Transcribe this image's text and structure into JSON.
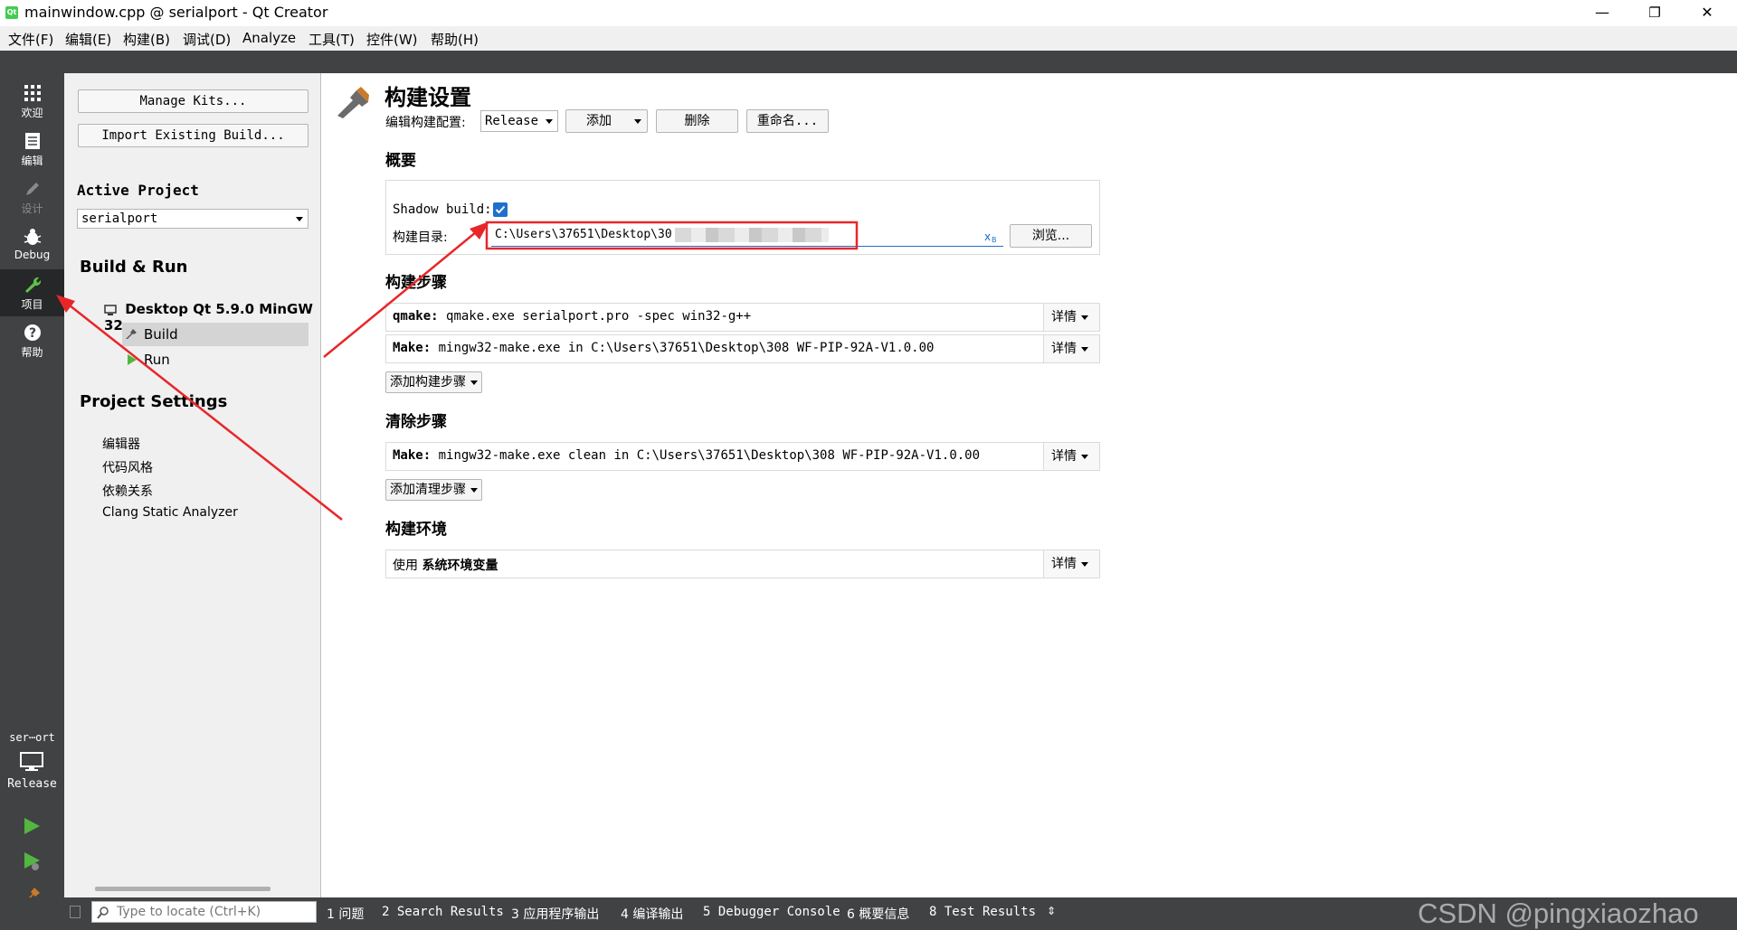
{
  "window": {
    "title": "mainwindow.cpp @ serialport - Qt Creator",
    "logo_text": "Qt",
    "minimize": "—",
    "restore": "❐",
    "close": "✕"
  },
  "menu": [
    "文件(F)",
    "编辑(E)",
    "构建(B)",
    "调试(D)",
    "Analyze",
    "工具(T)",
    "控件(W)",
    "帮助(H)"
  ],
  "modes": [
    {
      "label": "欢迎",
      "icon": "grid-icon"
    },
    {
      "label": "编辑",
      "icon": "document-icon"
    },
    {
      "label": "设计",
      "icon": "pencil-icon"
    },
    {
      "label": "Debug",
      "icon": "bug-icon"
    },
    {
      "label": "项目",
      "icon": "wrench-icon"
    },
    {
      "label": "帮助",
      "icon": "help-icon"
    }
  ],
  "kit_selector": {
    "project": "ser⋯ort",
    "config": "Release"
  },
  "nav": {
    "manage_kits": "Manage Kits...",
    "import_build": "Import Existing Build...",
    "active_project_label": "Active Project",
    "active_project": "serialport",
    "build_run_label": "Build & Run",
    "kit_name": "Desktop Qt 5.9.0 MinGW 32",
    "build": "Build",
    "run": "Run",
    "project_settings_label": "Project Settings",
    "settings": [
      "编辑器",
      "代码风格",
      "依赖关系",
      "Clang Static Analyzer"
    ]
  },
  "main": {
    "title": "构建设置",
    "edit_config_label": "编辑构建配置:",
    "config_value": "Release",
    "add_btn": "添加",
    "delete_btn": "删除",
    "rename_btn": "重命名...",
    "overview_label": "概要",
    "shadow_build_label": "Shadow build:",
    "build_dir_label": "构建目录:",
    "build_dir_value": "C:\\Users\\37651\\Desktop\\30",
    "browse_btn": "浏览...",
    "build_steps_label": "构建步骤",
    "qmake_prefix": "qmake:",
    "qmake_cmd": "qmake.exe serialport.pro -spec win32-g++",
    "make_prefix": "Make:",
    "make_cmd": "mingw32-make.exe in C:\\Users\\37651\\Desktop\\308 WF-PIP-92A-V1.0.00",
    "details": "详情",
    "add_build_step": "添加构建步骤",
    "clean_steps_label": "清除步骤",
    "clean_prefix": "Make:",
    "clean_cmd": "mingw32-make.exe clean in C:\\Users\\37651\\Desktop\\308 WF-PIP-92A-V1.0.00",
    "add_clean_step": "添加清理步骤",
    "build_env_label": "构建环境",
    "env_use": "使用",
    "env_value": "系统环境变量"
  },
  "bottom": {
    "locator_placeholder": "Type to locate (Ctrl+K)",
    "tabs": [
      "1 问题",
      "2 Search Results",
      "3 应用程序输出",
      "4 编译输出",
      "5 Debugger Console",
      "6 概要信息",
      "8 Test Results"
    ]
  },
  "watermark": "CSDN @pingxiaozhao",
  "colors": {
    "annotation": "#e8262a",
    "sidebar": "#404244",
    "active_mode": "#262728",
    "checkbox": "#1f6fce"
  }
}
